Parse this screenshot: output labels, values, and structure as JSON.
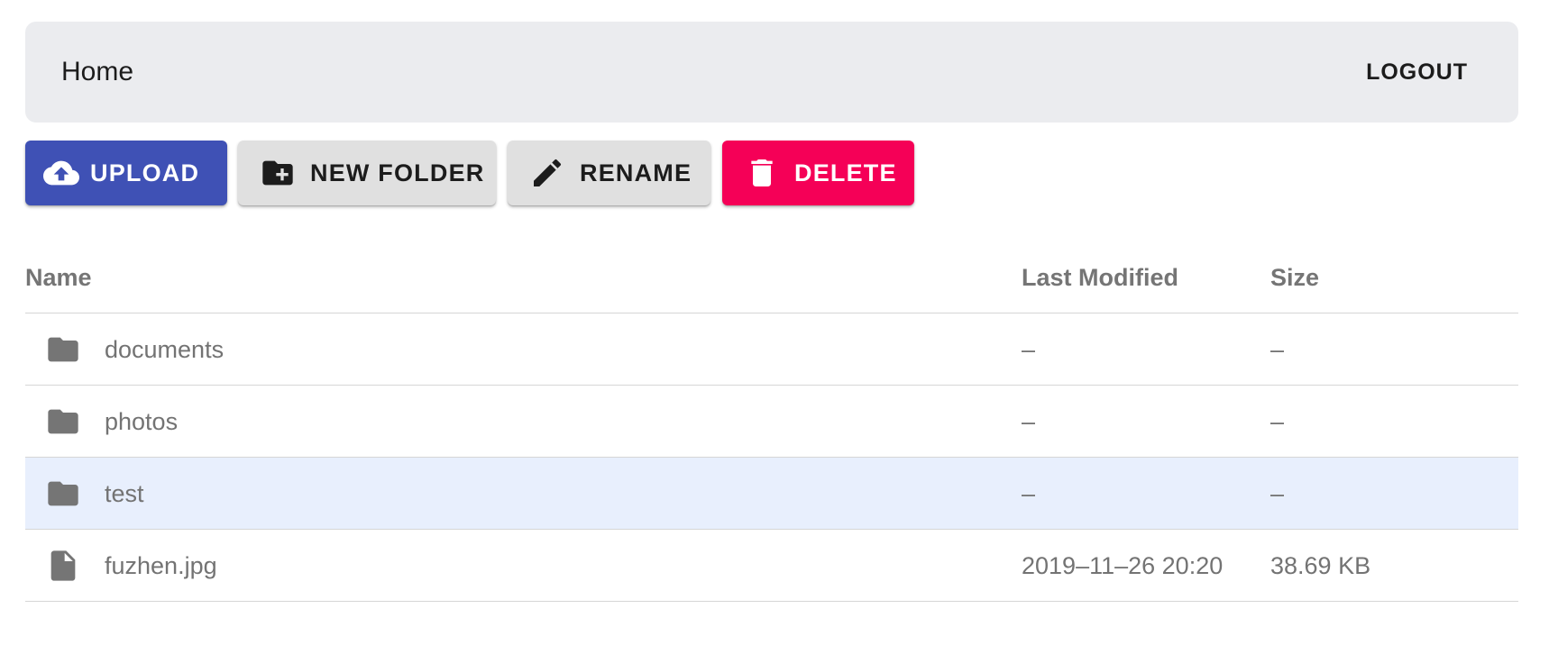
{
  "appbar": {
    "title": "Home",
    "logout_label": "LOGOUT"
  },
  "toolbar": {
    "upload_label": "UPLOAD",
    "new_folder_label": "NEW FOLDER",
    "rename_label": "RENAME",
    "delete_label": "DELETE",
    "upload_icon": "cloud-upload-icon",
    "new_folder_icon": "create-new-folder-icon",
    "rename_icon": "pencil-icon",
    "delete_icon": "trash-icon"
  },
  "colors": {
    "primary": "#3f51b5",
    "secondary": "#f50057",
    "default_button": "#e0e0e0",
    "appbar_bg": "#ebecef",
    "selected_row": "#e8effd",
    "text_muted": "#737373"
  },
  "table": {
    "headers": {
      "name": "Name",
      "last_modified": "Last Modified",
      "size": "Size"
    },
    "rows": [
      {
        "type": "folder",
        "icon": "folder-icon",
        "name": "documents",
        "last_modified": "–",
        "size": "–",
        "selected": false
      },
      {
        "type": "folder",
        "icon": "folder-icon",
        "name": "photos",
        "last_modified": "–",
        "size": "–",
        "selected": false
      },
      {
        "type": "folder",
        "icon": "folder-icon",
        "name": "test",
        "last_modified": "–",
        "size": "–",
        "selected": true
      },
      {
        "type": "file",
        "icon": "file-icon",
        "name": "fuzhen.jpg",
        "last_modified": "2019–11–26 20:20",
        "size": "38.69 KB",
        "selected": false
      }
    ]
  }
}
